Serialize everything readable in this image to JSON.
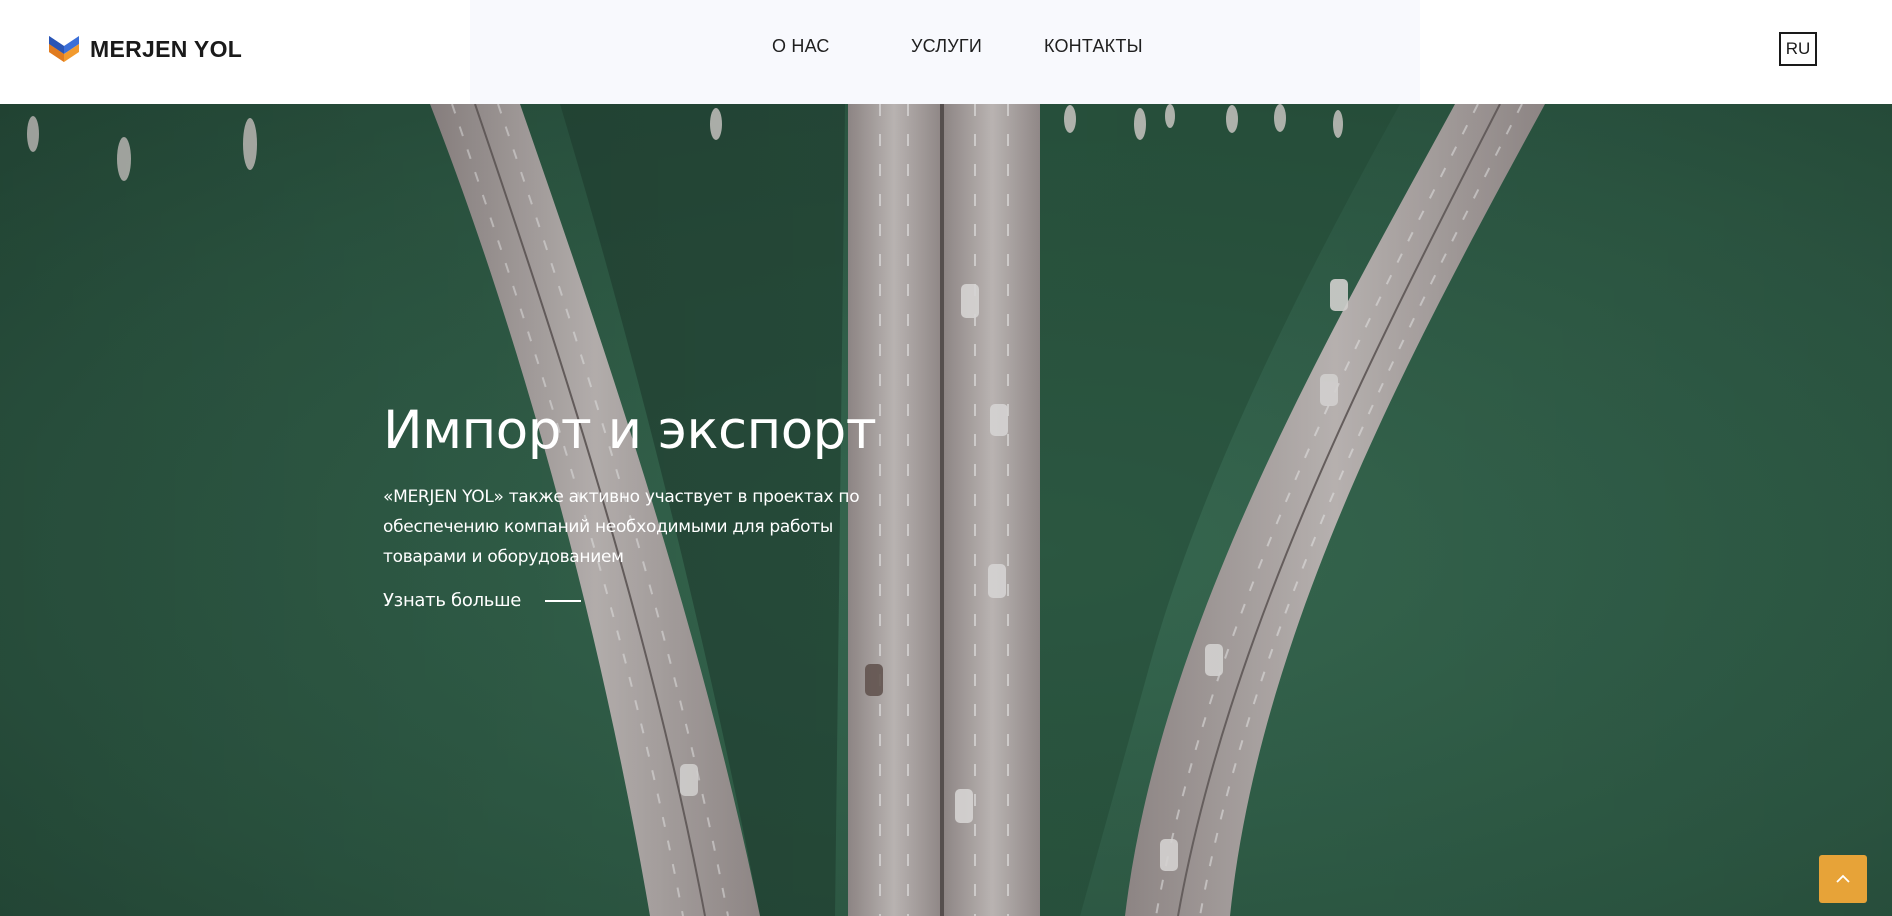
{
  "header": {
    "brand": "MERJEN YOL",
    "nav": {
      "about": "О НАС",
      "services": "УСЛУГИ",
      "contacts": "КОНТАКТЫ"
    },
    "language": "RU"
  },
  "hero": {
    "title": "Импорт и экспорт",
    "text": "«MERJEN YOL» также активно участвует в проектах по обеспечению компаний необходимыми для работы товарами и оборудованием",
    "more_label": "Узнать больше",
    "background": "aerial view of highway bridges over green water"
  },
  "icons": {
    "logo": "merjen-yol-logo-icon",
    "scroll_top": "chevron-up-icon"
  },
  "colors": {
    "header_bg": "#ffffff",
    "nav_text": "#1f1f1f",
    "water": "#2f5a45",
    "accent": "#e7a338",
    "logo_blue": "#3b6fd8",
    "logo_orange": "#f29a2e"
  }
}
